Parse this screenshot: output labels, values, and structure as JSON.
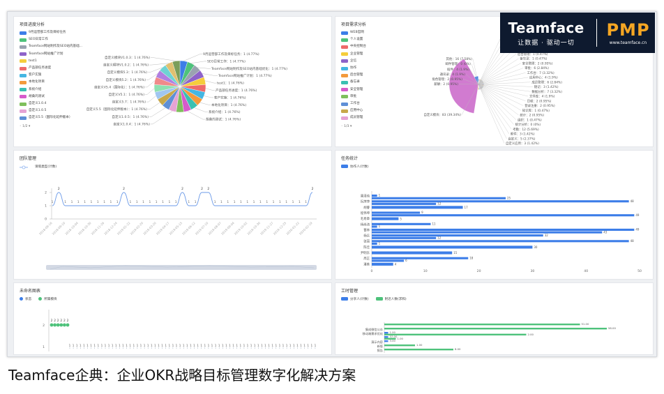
{
  "brand": {
    "name": "Teamface",
    "slogan": "让数据 · 驱动一切",
    "product": "PMP",
    "url": "www.teamface.cn"
  },
  "caption": "Teamface企典：企业OKR战略目标管理数字化解决方案",
  "panels": {
    "progress": {
      "title": "项目进度分析",
      "pager": "◦ 1/2 ▾",
      "colors": [
        "#3d7ee8",
        "#4ec27b",
        "#9aa3b0",
        "#8e63c9",
        "#f5cd3c",
        "#ee6a6a",
        "#45b6e2",
        "#f39a3c",
        "#3ac0b2",
        "#d65bcb",
        "#7fbf5c",
        "#e5a3d4",
        "#5f8fd6",
        "#c8a84a",
        "#a0c6f0",
        "#8ee0b0",
        "#f08a8a",
        "#b17fe0",
        "#6ed3d3",
        "#e0c070",
        "#7a9e5a"
      ],
      "legend": [
        "9月运营部工作及目标任务",
        "SEO日常工作",
        "Teamface网站制作及SEO站内基础...",
        "Teamface网站推广计划",
        "test1",
        "产品部任务进度",
        "客户实施",
        "本地化项目",
        "系统介绍",
        "胡桑的测试",
        "自定义1.0.4",
        "自定义1.0.5",
        "自定义5.5（国际化延伸版本）"
      ],
      "labels_left": [
        "自定义模块V1.0.3：1 (4.76%)",
        "自定义模块V1.0.2：1 (4.76%)",
        "自定义模块5.3：1 (4.76%)",
        "自定义模块5.2：1 (4.76%)",
        "自定义V5.4（国际化）：1 (4.76%)",
        "自定义V5.1：1 (4.76%)",
        "自定义5.7：1 (4.76%)",
        "自定义5.5（国际化延伸版本）：1 (4.76%)",
        "自定义1.0.5：1 (4.76%)",
        "自定义1.0.4：1 (4.76%)"
      ],
      "labels_right": [
        "9月运营部工作及目标任务：1 (4.77%)",
        "SEO日常工作：1 (4.77%)",
        "Teamface网站制作及SEO站内基础优化：1 (4.77%)",
        "Teamface网站推广计划：1 (4.77%)",
        "test1：1 (4.76%)",
        "产品部任务进度：1 (4.76%)",
        "客户实施：1 (4.76%)",
        "本地化项目：1 (4.76%)",
        "系统介绍：1 (4.76%)",
        "胡桑的测试：1 (4.76%)"
      ]
    },
    "demand": {
      "title": "项目需求分析",
      "pager": "◦ 1/3 ▾",
      "legend": [
        "WEB官网",
        "个人设置",
        "中央控制台",
        "企业管理",
        "企信",
        "协作",
        "后台管理",
        "备忘录",
        "安全管理",
        "审批",
        "工作台",
        "应用中心",
        "成员管理"
      ],
      "legend_colors": [
        "#3d7ee8",
        "#4ec27b",
        "#ee6a6a",
        "#f5cd3c",
        "#8e63c9",
        "#45b6e2",
        "#f39a3c",
        "#3ac0b2",
        "#d65bcb",
        "#7fbf5c",
        "#5f8fd6",
        "#c8a84a",
        "#e5a3d4"
      ],
      "labels_left": [
        "其他：16 (7.58%)",
        "邮件管理：0 (0%)",
        "插件：4 (1.9%)",
        "通讯录：4 (1.9%)",
        "角色管理：2 (0.95%)",
        "薪酬：2 (0.95%)",
        "自定义模块：83 (39.34%)"
      ],
      "labels_right": [
        "文件库：4 (1.9%)",
        "基础：1 (0.47%)",
        "企业：4 (1.9%)",
        "全局：5 (2.37%)",
        "协作：13 (6.16%)",
        "后台管理：1 (0.47%)",
        "备忘录：1 (0.47%)",
        "安全管理：2 (0.95%)",
        "审批：6 (2.84%)",
        "工作台：7 (3.32%)",
        "应用中心：4 (1.9%)",
        "成员管理：6 (2.84%)",
        "随记：3 (1.42%)",
        "数据分析：7 (3.32%)",
        "文件库：4 (1.9%)",
        "日程：2 (0.95%)",
        "登录注册：2 (0.95%)",
        "知识库：1 (0.47%)",
        "统计：2 (0.95%)",
        "组织：1 (0.47%)",
        "统计分析：0 (0%)",
        "考勤：12 (5.69%)",
        "邮件：3 (1.42%)",
        "自定义：5 (2.37%)",
        "自定义应用：3 (1.42%)"
      ]
    },
    "team": {
      "title": "团队管理",
      "legend": "请假类型(计数)",
      "chart_data": {
        "type": "line",
        "series": [
          {
            "name": "请假类型(计数)",
            "values": [
              1,
              2,
              1,
              1,
              1,
              1,
              1,
              1,
              1,
              1,
              1,
              2,
              1,
              1,
              1,
              1,
              1,
              1,
              1,
              1,
              2,
              1,
              1,
              2,
              2,
              1,
              1,
              1,
              1,
              1,
              1,
              1,
              1,
              1,
              1,
              1,
              1,
              1,
              1,
              1,
              2
            ]
          }
        ],
        "x": [
          "2018-08-16",
          "2018-08-29",
          "2018-09-10",
          "2018-09-21",
          "2018-10-04",
          "2018-10-17",
          "2018-10-30",
          "2018-11-12",
          "2018-11-26",
          "2018-12-10",
          "2018-12-24",
          "2019-01-08",
          "2019-01-22",
          "2019-02-06",
          "2019-02-20",
          "2019-03-06",
          "2019-03-20",
          "2019-04-03",
          "2019-04-17",
          "2019-05-01",
          "2019-05-15",
          "2019-05-29",
          "2019-06-12",
          "2019-06-26",
          "2019-07-10",
          "2019-07-24",
          "2019-08-07",
          "2019-08-21",
          "2019-09-04",
          "2019-09-18",
          "2019-10-02",
          "2019-10-16",
          "2019-10-30",
          "2019-11-13",
          "2019-11-27",
          "2019-12-11",
          "2019-12-25",
          "2020-01-08",
          "2020-01-22",
          "2020-02-05",
          "2020-02-19"
        ],
        "ylim": [
          0,
          2
        ],
        "yticks": [
          "0",
          "1",
          "2"
        ]
      }
    },
    "task": {
      "title": "任务统计",
      "legend": "协作人(计数)",
      "chart_data": {
        "type": "bar",
        "categories": [
          "雷清纯",
          "阮萍萍",
          "胡睿",
          "程伟坤",
          "毛易章",
          "杨尚涛",
          "曹林",
          "杨兵",
          "张丽",
          "陈佳",
          "张宗博",
          "尹明东",
          "周正",
          "潘善"
        ],
        "series": [
          {
            "name": "协作人(计数)",
            "values": [
              1,
              25,
              48,
              12,
              17,
              9,
              49,
              5,
              11,
              1,
              49,
              43,
              32,
              12,
              48,
              1,
              30,
              15,
              18,
              6,
              4
            ]
          }
        ],
        "rows": [
          {
            "label": "雷清纯",
            "values": [
              1,
              25
            ]
          },
          {
            "label": "阮萍萍",
            "values": [
              48,
              12
            ]
          },
          {
            "label": "胡睿",
            "values": [
              17
            ]
          },
          {
            "label": "程伟坤",
            "values": [
              9,
              49
            ]
          },
          {
            "label": "毛易章",
            "values": [
              5
            ]
          },
          {
            "label": "杨尚涛",
            "values": [
              11,
              1
            ]
          },
          {
            "label": "曹林",
            "values": [
              49,
              43
            ]
          },
          {
            "label": "杨兵",
            "values": [
              32,
              12
            ]
          },
          {
            "label": "张丽",
            "values": [
              48,
              1
            ]
          },
          {
            "label": "陈佳",
            "values": [
              30
            ]
          },
          {
            "label": "尹明东",
            "values": [
              15
            ]
          },
          {
            "label": "周正",
            "values": [
              18,
              6
            ]
          },
          {
            "label": "潘善",
            "values": [
              4
            ]
          }
        ],
        "xlim": [
          0,
          50
        ],
        "xticks": [
          "0",
          "10",
          "20",
          "30",
          "40",
          "50"
        ]
      }
    },
    "unnamed": {
      "title": "未命名图表",
      "legend": [
        "状态",
        "所属模块"
      ],
      "legend_colors": [
        "#3d7ee8",
        "#4ec27b"
      ],
      "chart_data": {
        "type": "scatter",
        "series": [
          {
            "name": "所属模块",
            "values": [
              2,
              2,
              2,
              2,
              2,
              2
            ]
          },
          {
            "name": "状态",
            "values": [
              1,
              1,
              1,
              1,
              1,
              1,
              1,
              1,
              1,
              1,
              1,
              1,
              1,
              1,
              1,
              1,
              1,
              1,
              1,
              1,
              1,
              1,
              1,
              1,
              1,
              1,
              1,
              1,
              1,
              1,
              1,
              1,
              1,
              1,
              1,
              1,
              1,
              1,
              1,
              1,
              1,
              1,
              1,
              1,
              1,
              1,
              1,
              1,
              1,
              1,
              1,
              1,
              1,
              1,
              1,
              1,
              1,
              1,
              1,
              1,
              1,
              1,
              1,
              1,
              1,
              1,
              1,
              1,
              1,
              1
            ]
          }
        ],
        "yticks": [
          "2",
          "1"
        ]
      }
    },
    "hours": {
      "title": "工时管理",
      "legend": [
        "分享人(计数)",
        "附近人数(求和)"
      ],
      "legend_colors": [
        "#3d7ee8",
        "#4ec27b"
      ],
      "chart_data": {
        "type": "bar",
        "categories": [
          "集成微信公众",
          "移动端需求优化",
          "演示内容",
          "新版",
          "报告"
        ],
        "series": [
          {
            "name": "分享人(计数)",
            "values": [
              1,
              1,
              1,
              1,
              1
            ]
          },
          {
            "name": "附近人数(求和)",
            "values": [
              51,
              58,
              2,
              37,
              3,
              8,
              18
            ]
          }
        ],
        "rows": [
          {
            "label": "",
            "values": [
              51
            ]
          },
          {
            "label": "集成微信公众",
            "values": [
              58
            ]
          },
          {
            "label": "移动端需求优化",
            "values": [
              1,
              37
            ]
          },
          {
            "label": "",
            "values": [
              1,
              3
            ]
          },
          {
            "label": "演示内容",
            "values": [
              1
            ]
          },
          {
            "label": "新版",
            "values": [
              8
            ]
          },
          {
            "label": "报告",
            "values": [
              18
            ]
          }
        ],
        "value_labels": [
          "51.00",
          "58.00",
          "1.00",
          "2.00",
          "37.00",
          "1.00",
          "3.00",
          "1.00",
          "8.00",
          "18.00"
        ]
      }
    }
  }
}
